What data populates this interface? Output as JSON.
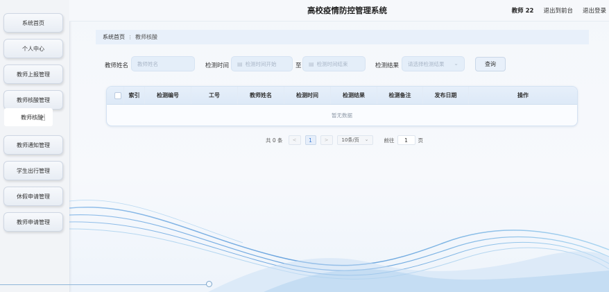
{
  "header": {
    "title": "高校疫情防控管理系统",
    "user": "教师 22",
    "to_front": "退出到前台",
    "logout": "退出登录"
  },
  "sidebar": {
    "items": [
      {
        "label": "系统首页"
      },
      {
        "label": "个人中心"
      },
      {
        "label": "教师上报管理"
      },
      {
        "label": "教师核酸管理"
      },
      {
        "label": "教师通知管理"
      },
      {
        "label": "学生出行管理"
      },
      {
        "label": "休假申请管理"
      },
      {
        "label": "教师申请管理"
      }
    ],
    "sub_item": {
      "label": "教师核酸"
    }
  },
  "breadcrumb": {
    "home": "系统首页",
    "current": "教师核酸"
  },
  "filters": {
    "name_label": "教师姓名",
    "name_placeholder": "教师姓名",
    "time_label": "检测时间",
    "time_start_placeholder": "检测时间开始",
    "to": "至",
    "time_end_placeholder": "检测时间结束",
    "result_label": "检测结果",
    "result_placeholder": "请选择检测结果",
    "query_button": "查询"
  },
  "table": {
    "columns": [
      "索引",
      "检测编号",
      "工号",
      "教师姓名",
      "检测时间",
      "检测结果",
      "检测备注",
      "发布日期",
      "操作"
    ],
    "empty_text": "暂无数据"
  },
  "pagination": {
    "total": "共 0 条",
    "prev": "<",
    "page": "1",
    "next": ">",
    "page_size": "10条/页",
    "goto_label": "前往",
    "goto_value": "1",
    "goto_suffix": "页"
  },
  "colors": {
    "accent": "#3a7bd5",
    "panel": "#e8f0fa",
    "wave_blue": "#4f93d8"
  }
}
